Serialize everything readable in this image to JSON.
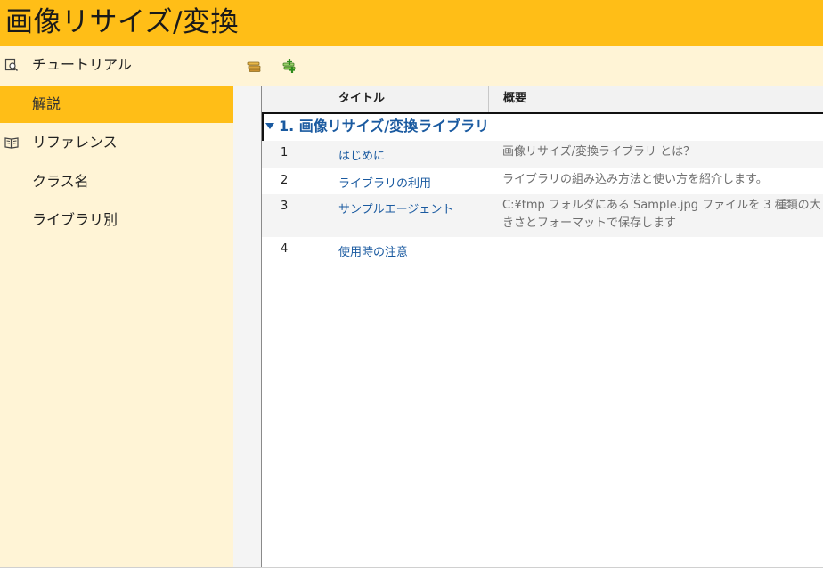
{
  "window": {
    "title": "画像リサイズ/変換"
  },
  "sidebar": {
    "items": [
      {
        "label": "チュートリアル",
        "icon": "search-document-icon"
      },
      {
        "label": "解説",
        "active": true
      },
      {
        "label": "リファレンス",
        "icon": "book-icon"
      },
      {
        "label": "クラス名"
      },
      {
        "label": "ライブラリ別"
      }
    ]
  },
  "toolbar": {
    "buttons": [
      {
        "name": "collapse-all-icon"
      },
      {
        "name": "expand-all-icon"
      }
    ]
  },
  "table": {
    "columns": [
      "タイトル",
      "概要"
    ],
    "group": {
      "title": "1. 画像リサイズ/変換ライブラリ"
    },
    "rows": [
      {
        "num": "1",
        "title": "はじめに",
        "summary": "画像リサイズ/変換ライブラリ とは？"
      },
      {
        "num": "2",
        "title": "ライブラリの利用",
        "summary": "ライブラリの組み込み方法と使い方を紹介します。"
      },
      {
        "num": "3",
        "title": "サンプルエージェント",
        "summary": "C:¥tmp フォルダにある Sample.jpg ファイルを 3 種類の大きさとフォーマットで保存します"
      },
      {
        "num": "4",
        "title": "使用時の注意",
        "summary": ""
      }
    ]
  },
  "colors": {
    "accent": "#ffbe17",
    "sidebar_bg": "#fff4d6",
    "link": "#1a5aa0"
  }
}
